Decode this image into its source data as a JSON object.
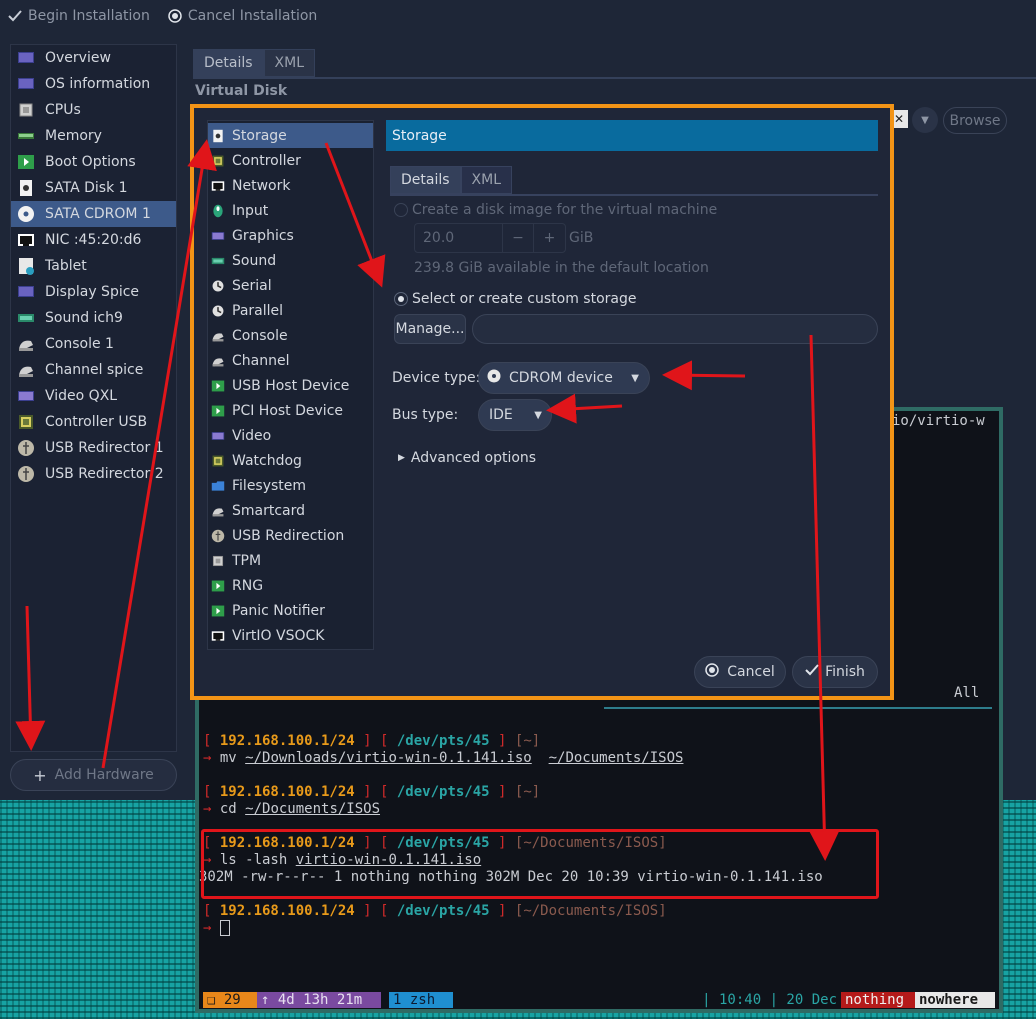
{
  "toolbar": {
    "begin_label": "Begin Installation",
    "cancel_label": "Cancel Installation"
  },
  "hardware_list": [
    {
      "label": "Overview",
      "icon": "monitor-icon"
    },
    {
      "label": "OS information",
      "icon": "monitor-icon"
    },
    {
      "label": "CPUs",
      "icon": "cpu-icon"
    },
    {
      "label": "Memory",
      "icon": "memory-icon"
    },
    {
      "label": "Boot Options",
      "icon": "boot-icon"
    },
    {
      "label": "SATA Disk 1",
      "icon": "disk-icon"
    },
    {
      "label": "SATA CDROM 1",
      "icon": "cdrom-icon",
      "selected": true
    },
    {
      "label": "NIC :45:20:d6",
      "icon": "nic-icon"
    },
    {
      "label": "Tablet",
      "icon": "tablet-icon"
    },
    {
      "label": "Display Spice",
      "icon": "display-icon"
    },
    {
      "label": "Sound ich9",
      "icon": "sound-icon"
    },
    {
      "label": "Console 1",
      "icon": "console-icon"
    },
    {
      "label": "Channel spice",
      "icon": "channel-icon"
    },
    {
      "label": "Video QXL",
      "icon": "video-icon"
    },
    {
      "label": "Controller USB",
      "icon": "controller-icon"
    },
    {
      "label": "USB Redirector 1",
      "icon": "usb-redirector-icon"
    },
    {
      "label": "USB Redirector 2",
      "icon": "usb-redirector-icon"
    }
  ],
  "add_hardware_label": "Add Hardware",
  "details_tabs": [
    "Details",
    "XML"
  ],
  "virtual_disk_label": "Virtual Disk",
  "browse_label": "Browse",
  "dialog": {
    "device_list": [
      {
        "label": "Storage",
        "icon": "storage-icon",
        "selected": true
      },
      {
        "label": "Controller",
        "icon": "controller-icon"
      },
      {
        "label": "Network",
        "icon": "network-icon"
      },
      {
        "label": "Input",
        "icon": "input-icon"
      },
      {
        "label": "Graphics",
        "icon": "graphics-icon"
      },
      {
        "label": "Sound",
        "icon": "sound-icon"
      },
      {
        "label": "Serial",
        "icon": "serial-icon"
      },
      {
        "label": "Parallel",
        "icon": "parallel-icon"
      },
      {
        "label": "Console",
        "icon": "console-icon"
      },
      {
        "label": "Channel",
        "icon": "channel-icon"
      },
      {
        "label": "USB Host Device",
        "icon": "usb-host-icon"
      },
      {
        "label": "PCI Host Device",
        "icon": "pci-host-icon"
      },
      {
        "label": "Video",
        "icon": "video-icon"
      },
      {
        "label": "Watchdog",
        "icon": "watchdog-icon"
      },
      {
        "label": "Filesystem",
        "icon": "folder-icon"
      },
      {
        "label": "Smartcard",
        "icon": "smartcard-icon"
      },
      {
        "label": "USB Redirection",
        "icon": "usb-redirection-icon"
      },
      {
        "label": "TPM",
        "icon": "tpm-icon"
      },
      {
        "label": "RNG",
        "icon": "rng-icon"
      },
      {
        "label": "Panic Notifier",
        "icon": "panic-icon"
      },
      {
        "label": "VirtIO VSOCK",
        "icon": "vsock-icon"
      }
    ],
    "header_title": "Storage",
    "tabs": [
      "Details",
      "XML"
    ],
    "create_disk_label": "Create a disk image for the virtual machine",
    "size_value": "20.0",
    "size_unit": "GiB",
    "available_text": "239.8 GiB available in the default location",
    "custom_storage_label": "Select or create custom storage",
    "manage_label": "Manage...",
    "path_value": "",
    "device_type_label": "Device type:",
    "device_type_value": "CDROM device",
    "bus_type_label": "Bus type:",
    "bus_type_value": "IDE",
    "advanced_label": "Advanced options",
    "cancel_label": "Cancel",
    "finish_label": "Finish"
  },
  "terminal": {
    "partial_text": "io/virtio-w",
    "all_label": "All",
    "ip": "192.168.100.1/24",
    "pts": "/dev/pts/45",
    "prompts": [
      {
        "cwd": "~",
        "cmd": "mv",
        "args": [
          "~/Downloads/virtio-win-0.1.141.iso",
          "~/Documents/ISOS"
        ]
      },
      {
        "cwd": "~",
        "cmd": "cd",
        "args": [
          "~/Documents/ISOS"
        ]
      },
      {
        "cwd": "~/Documents/ISOS",
        "cmd": "ls -lash",
        "args": [
          "virtio-win-0.1.141.iso"
        ]
      },
      {
        "cwd": "~/Documents/ISOS",
        "cmd": "",
        "args": []
      }
    ],
    "ls_output": "302M -rw-r--r-- 1 nothing nothing 302M Dec 20 10:39 virtio-win-0.1.141.iso",
    "status": {
      "window_num": "❑ 29",
      "uptime": "↑ 4d 13h 21m",
      "session": "1 zsh",
      "time": "| 10:40 | 20 Dec",
      "user": "nothing",
      "host": "nowhere"
    }
  },
  "colors": {
    "annotation_red": "#e0151a",
    "dialog_border": "#f39416",
    "selection_blue": "#3d5a8a",
    "header_blue": "#096b9e"
  }
}
